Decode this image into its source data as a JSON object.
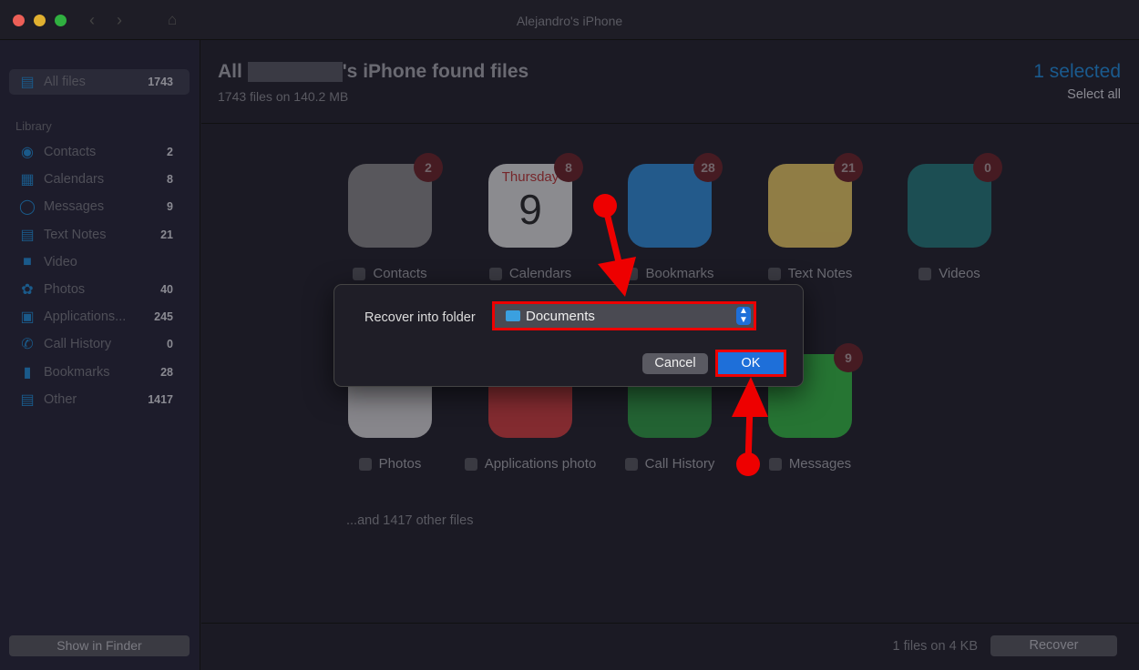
{
  "window": {
    "title": "Alejandro's iPhone"
  },
  "sidebar": {
    "all_files": {
      "label": "All files",
      "count": "1743"
    },
    "library_label": "Library",
    "items": [
      {
        "label": "Contacts",
        "count": "2",
        "icon": "contact-icon"
      },
      {
        "label": "Calendars",
        "count": "8",
        "icon": "calendar-icon"
      },
      {
        "label": "Messages",
        "count": "9",
        "icon": "message-icon"
      },
      {
        "label": "Text Notes",
        "count": "21",
        "icon": "notes-icon"
      },
      {
        "label": "Video",
        "count": "",
        "icon": "video-icon"
      },
      {
        "label": "Photos",
        "count": "40",
        "icon": "photos-icon"
      },
      {
        "label": "Applications...",
        "count": "245",
        "icon": "applications-icon"
      },
      {
        "label": "Call History",
        "count": "0",
        "icon": "phone-icon"
      },
      {
        "label": "Bookmarks",
        "count": "28",
        "icon": "bookmark-icon"
      },
      {
        "label": "Other",
        "count": "1417",
        "icon": "folder-icon"
      }
    ],
    "show_in_finder": "Show in Finder"
  },
  "header": {
    "title_prefix": "All",
    "title_suffix": "'s iPhone found files",
    "subtitle": "1743 files on 140.2 MB",
    "selected": "1 selected",
    "select_all": "Select all"
  },
  "tiles": [
    {
      "label": "Contacts",
      "badge": "2",
      "color": "#8a8a8a"
    },
    {
      "label": "Calendars",
      "badge": "8",
      "color": "#e8e8e8",
      "day": "Thursday",
      "date": "9"
    },
    {
      "label": "Bookmarks",
      "badge": "28",
      "color": "#2a8fe0"
    },
    {
      "label": "Text Notes",
      "badge": "21",
      "color": "#f0d060"
    },
    {
      "label": "Videos",
      "badge": "0",
      "color": "#1e7a7a"
    },
    {
      "label": "Photos",
      "badge": "",
      "color": "#e0e0e0"
    },
    {
      "label": "Applications photo",
      "badge": "",
      "color": "#d83a3a"
    },
    {
      "label": "Call History",
      "badge": "",
      "color": "#2aa040"
    },
    {
      "label": "Messages",
      "badge": "9",
      "color": "#30c040"
    }
  ],
  "other_files": "...and 1417 other files",
  "footer": {
    "info": "1 files on 4 KB",
    "recover": "Recover"
  },
  "dialog": {
    "label": "Recover into folder",
    "folder": "Documents",
    "cancel": "Cancel",
    "ok": "OK"
  },
  "colors": {
    "accent": "#1e6fd9",
    "annotation": "#e00000"
  }
}
